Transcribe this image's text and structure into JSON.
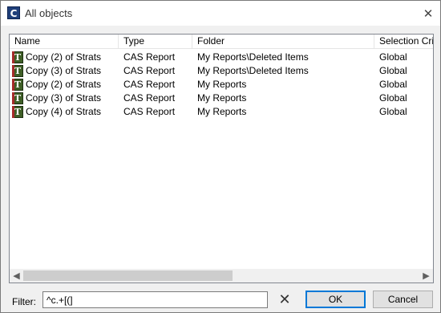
{
  "window": {
    "title": "All objects",
    "app_icon": "C"
  },
  "list": {
    "columns": [
      "Name",
      "Type",
      "Folder",
      "Selection Crite"
    ],
    "rows": [
      {
        "name": "Copy (2) of Strats",
        "type": "CAS Report",
        "folder": "My Reports\\Deleted Items",
        "selection": "Global"
      },
      {
        "name": "Copy (3) of Strats",
        "type": "CAS Report",
        "folder": "My Reports\\Deleted Items",
        "selection": "Global"
      },
      {
        "name": "Copy (2) of Strats",
        "type": "CAS Report",
        "folder": "My Reports",
        "selection": "Global"
      },
      {
        "name": "Copy (3) of Strats",
        "type": "CAS Report",
        "folder": "My Reports",
        "selection": "Global"
      },
      {
        "name": "Copy (4) of Strats",
        "type": "CAS Report",
        "folder": "My Reports",
        "selection": "Global"
      }
    ],
    "row_icon": "T"
  },
  "footer": {
    "filter_label": "Filter:",
    "filter_value": "^c.+[(]",
    "ok_label": "OK",
    "cancel_label": "Cancel"
  },
  "icons": {
    "app": "app-icon",
    "close": "close-icon",
    "row": "report-icon",
    "clear": "clear-filter-icon",
    "scroll_left": "chevron-left-icon",
    "scroll_right": "chevron-right-icon"
  },
  "colors": {
    "window_bg": "#f0f0f0",
    "list_bg": "#ffffff",
    "default_button_border": "#0078d7",
    "report_icon": "#3e5e26"
  }
}
